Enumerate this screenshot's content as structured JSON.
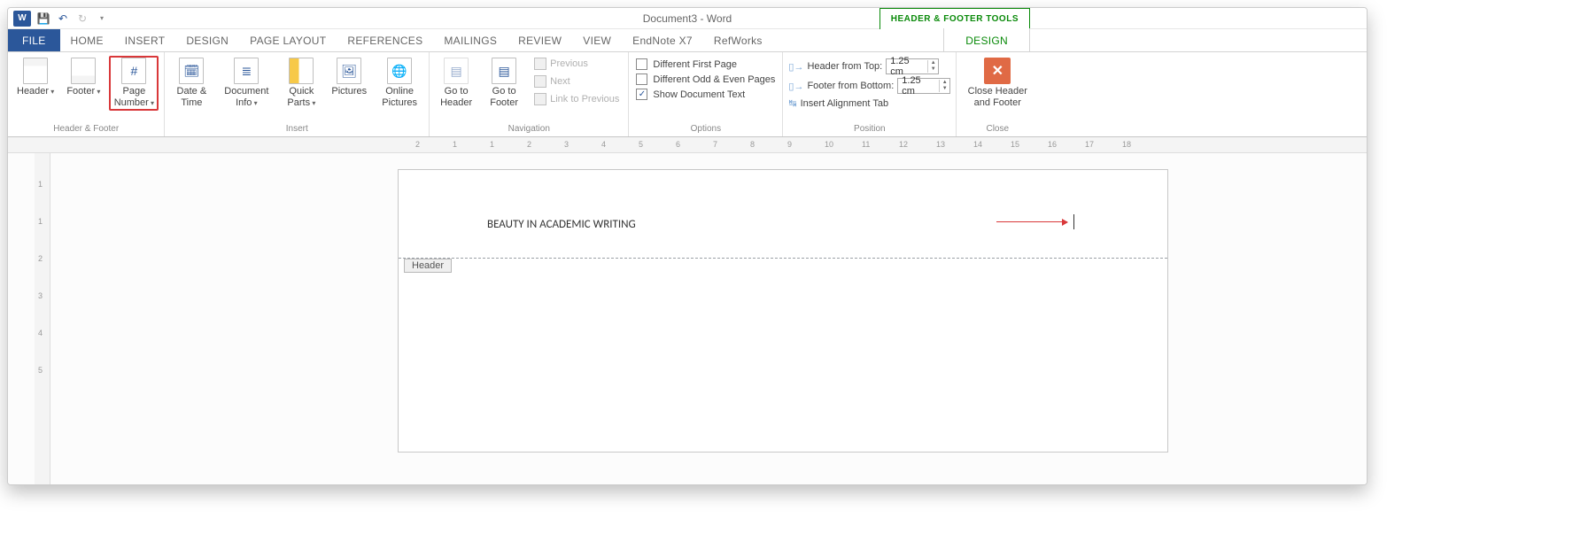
{
  "title": "Document3 - Word",
  "context_tab_group": "HEADER & FOOTER TOOLS",
  "tabs": [
    "FILE",
    "HOME",
    "INSERT",
    "DESIGN",
    "PAGE LAYOUT",
    "REFERENCES",
    "MAILINGS",
    "REVIEW",
    "VIEW",
    "EndNote X7",
    "RefWorks"
  ],
  "context_tab": "DESIGN",
  "ribbon": {
    "header_footer": {
      "label": "Header & Footer",
      "header": "Header",
      "footer": "Footer",
      "page_number": "Page Number"
    },
    "insert": {
      "label": "Insert",
      "date_time": "Date & Time",
      "doc_info": "Document Info",
      "quick_parts": "Quick Parts",
      "pictures": "Pictures",
      "online_pictures": "Online Pictures"
    },
    "navigation": {
      "label": "Navigation",
      "goto_header": "Go to Header",
      "goto_footer": "Go to Footer",
      "previous": "Previous",
      "next": "Next",
      "link_prev": "Link to Previous"
    },
    "options": {
      "label": "Options",
      "diff_first": "Different First Page",
      "diff_odd_even": "Different Odd & Even Pages",
      "show_doc_text": "Show Document Text"
    },
    "position": {
      "label": "Position",
      "header_top": "Header from Top:",
      "footer_bottom": "Footer from Bottom:",
      "header_val": "1.25 cm",
      "footer_val": "1.25 cm",
      "align_tab": "Insert Alignment Tab"
    },
    "close": {
      "label": "Close",
      "btn": "Close Header and Footer"
    }
  },
  "ruler_h": [
    2,
    1,
    1,
    2,
    3,
    4,
    5,
    6,
    7,
    8,
    9,
    10,
    11,
    12,
    13,
    14,
    15,
    16,
    17,
    18
  ],
  "ruler_v": [
    1,
    1,
    2,
    3,
    4,
    5
  ],
  "document": {
    "header_text": "BEAUTY IN ACADEMIC WRITING",
    "header_tag": "Header"
  }
}
